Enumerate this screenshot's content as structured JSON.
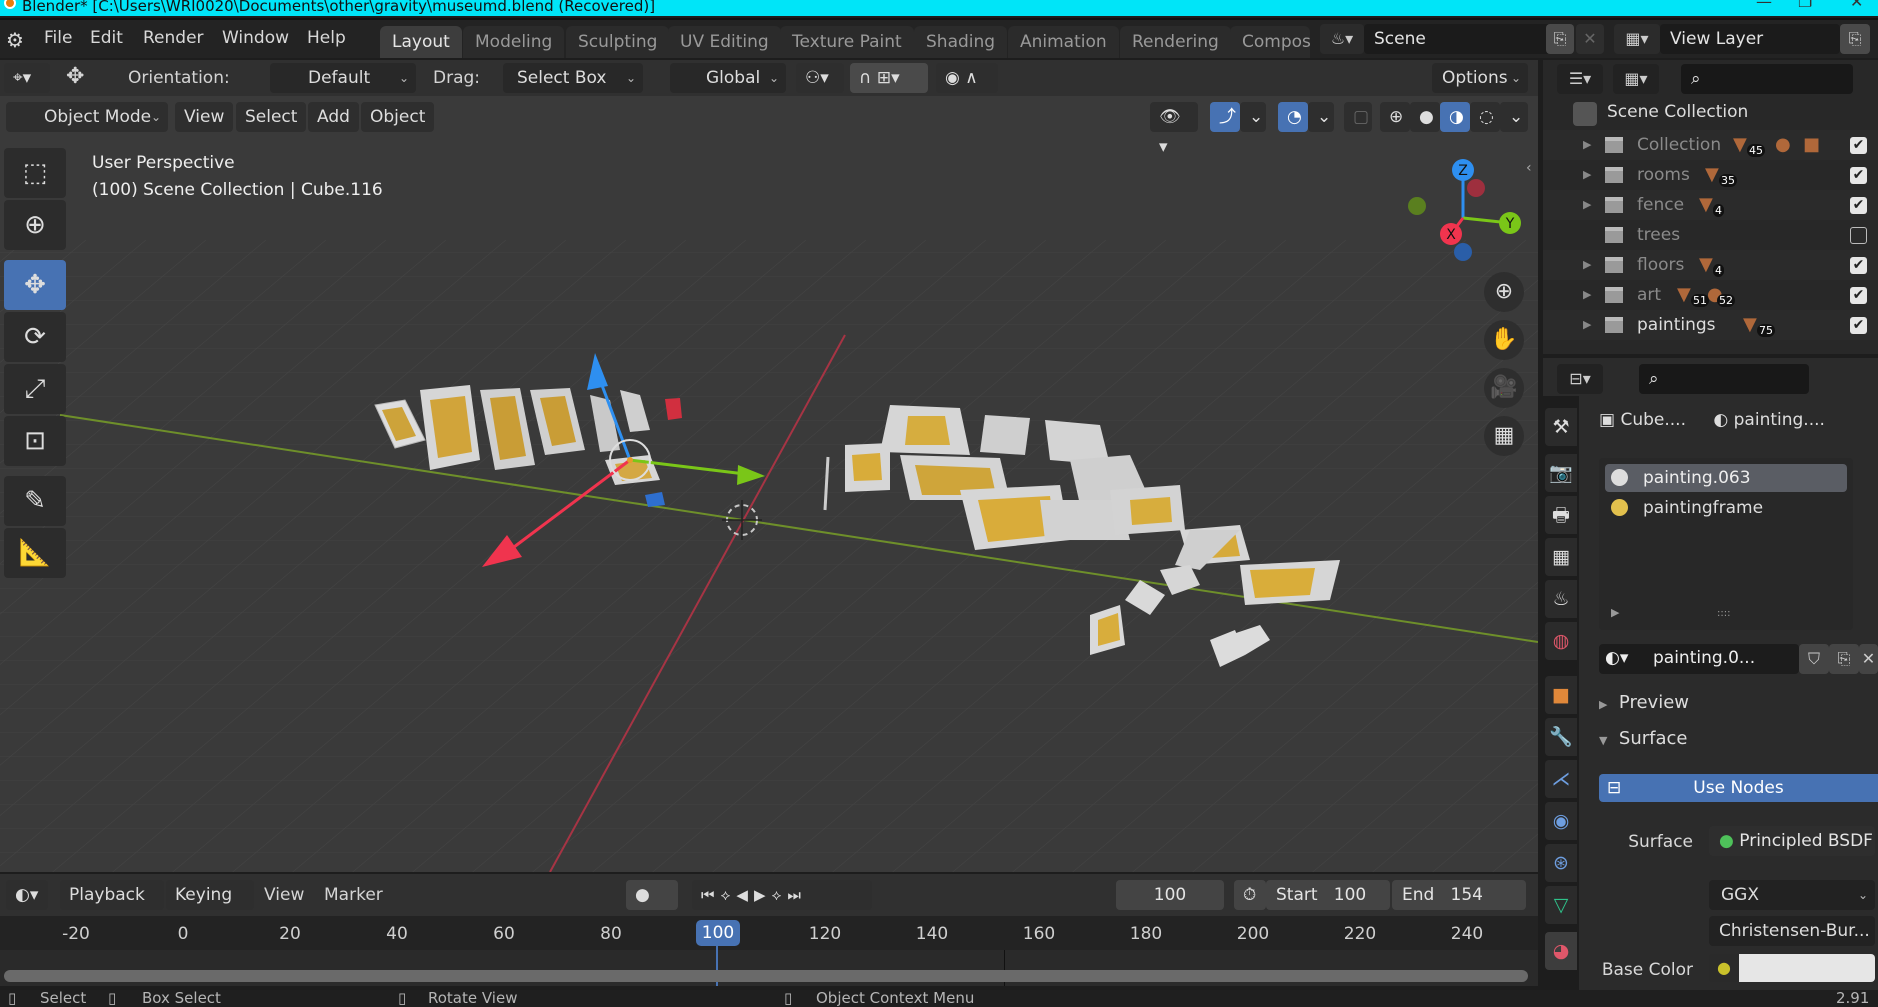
{
  "window": {
    "title": "Blender* [C:\\Users\\WRI0020\\Documents\\other\\gravity\\museumd.blend (Recovered)]"
  },
  "menu": {
    "items": [
      "File",
      "Edit",
      "Render",
      "Window",
      "Help"
    ]
  },
  "workspaces": {
    "tabs": [
      "Layout",
      "Modeling",
      "Sculpting",
      "UV Editing",
      "Texture Paint",
      "Shading",
      "Animation",
      "Rendering",
      "Compos"
    ],
    "active": "Layout"
  },
  "scene": {
    "name": "Scene",
    "view_layer": "View Layer"
  },
  "tool_settings": {
    "orientation_label": "Orientation:",
    "orientation_value": "Default",
    "drag_label": "Drag:",
    "drag_value": "Select Box",
    "transform_orientation": "Global",
    "options_label": "Options"
  },
  "viewport_header": {
    "mode": "Object Mode",
    "menus": [
      "View",
      "Select",
      "Add",
      "Object"
    ]
  },
  "viewport": {
    "overlay_line1": "User Perspective",
    "overlay_line2": "(100) Scene Collection | Cube.116",
    "gizmo_axes": {
      "x": "X",
      "y": "Y",
      "z": "Z"
    },
    "axis_colors": {
      "x": "#f0344e",
      "y": "#7ac618",
      "z": "#2e8ff0"
    }
  },
  "outliner": {
    "root": "Scene Collection",
    "rows": [
      {
        "name": "Collection",
        "meshes": "45",
        "extra": "light,camera",
        "checked": true,
        "expandable": true
      },
      {
        "name": "rooms",
        "meshes": "35",
        "checked": true,
        "expandable": true
      },
      {
        "name": "fence",
        "meshes": "4",
        "checked": true,
        "expandable": true
      },
      {
        "name": "trees",
        "meshes": "",
        "checked": false,
        "expandable": false
      },
      {
        "name": "floors",
        "meshes": "4",
        "checked": true,
        "expandable": true
      },
      {
        "name": "art",
        "meshes": "51",
        "lights": "52",
        "checked": true,
        "expandable": true
      },
      {
        "name": "paintings",
        "meshes": "75",
        "checked": true,
        "expandable": true
      }
    ]
  },
  "properties": {
    "breadcrumb_object": "Cube....",
    "breadcrumb_material": "painting....",
    "material_slots": [
      "painting.063",
      "paintingframe"
    ],
    "active_slot": "painting.063",
    "material_name": "painting.0...",
    "panels": {
      "preview": "Preview",
      "surface": "Surface"
    },
    "use_nodes_label": "Use Nodes",
    "surface_label": "Surface",
    "surface_value": "Principled BSDF",
    "distribution": "GGX",
    "subsurface_method": "Christensen-Bur...",
    "base_color_label": "Base Color",
    "base_color": "#e6e6e6"
  },
  "timeline": {
    "menus": [
      "Playback",
      "Keying",
      "View",
      "Marker"
    ],
    "current_frame": "100",
    "start_label": "Start",
    "start": "100",
    "end_label": "End",
    "end": "154",
    "ticks": [
      "-20",
      "0",
      "20",
      "40",
      "60",
      "80",
      "100",
      "120",
      "140",
      "160",
      "180",
      "200",
      "220",
      "240"
    ]
  },
  "statusbar": {
    "select": "Select",
    "box_select": "Box Select",
    "rotate_view": "Rotate View",
    "context_menu": "Object Context Menu",
    "version": "2.91"
  }
}
